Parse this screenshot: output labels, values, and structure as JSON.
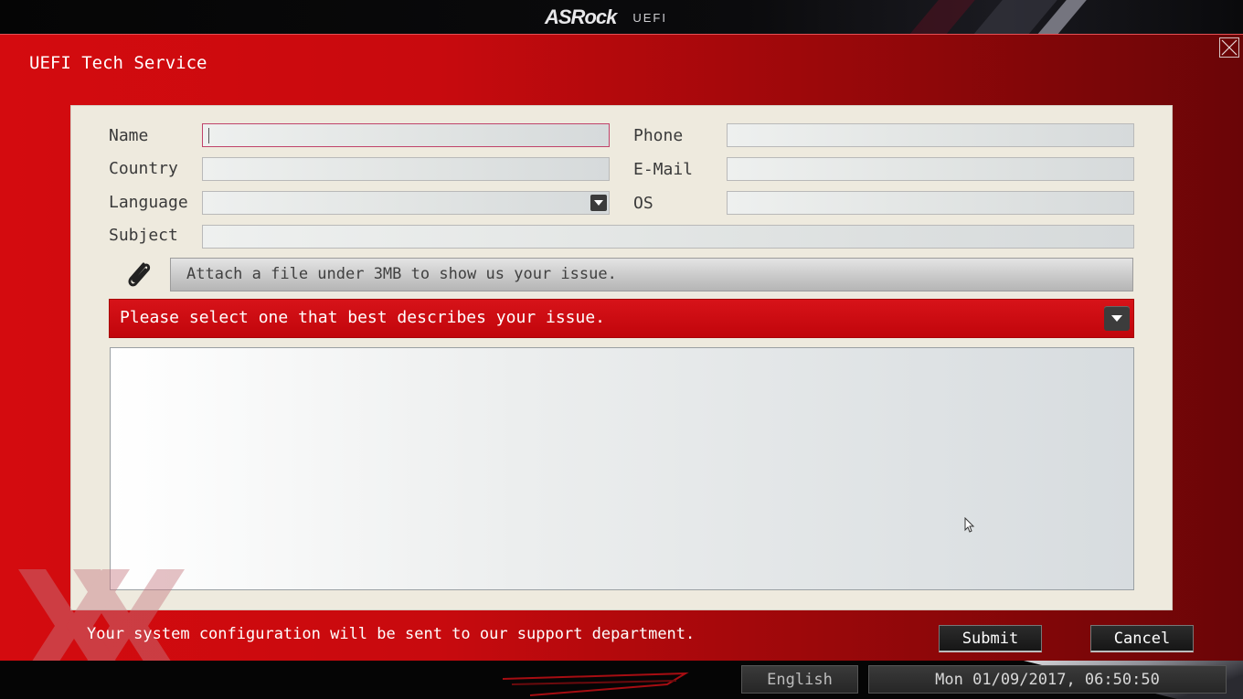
{
  "header": {
    "brand": "ASRock",
    "product": "UEFI"
  },
  "window": {
    "title": "UEFI Tech Service"
  },
  "form": {
    "name_label": "Name",
    "country_label": "Country",
    "language_label": "Language",
    "subject_label": "Subject",
    "phone_label": "Phone",
    "email_label": "E-Mail",
    "os_label": "OS",
    "name_value": "",
    "country_value": "",
    "language_value": "",
    "subject_value": "",
    "phone_value": "",
    "email_value": "",
    "os_value": ""
  },
  "attachment": {
    "text": "Attach a file under 3MB to show us your issue."
  },
  "issue": {
    "placeholder": "Please select one that best describes your issue."
  },
  "description": {
    "value": ""
  },
  "footer": {
    "note": "Your system configuration will be sent to our support department.",
    "submit_label": "Submit",
    "cancel_label": "Cancel"
  },
  "statusbar": {
    "language": "English",
    "datetime": "Mon 01/09/2017, 06:50:50"
  },
  "icons": {
    "close": "close-icon",
    "attach": "paperclip-icon",
    "dropdown": "chevron-down-icon"
  },
  "colors": {
    "accent_red": "#c8090e",
    "panel_bg": "#eeeade",
    "focus_border": "#c0436a"
  }
}
